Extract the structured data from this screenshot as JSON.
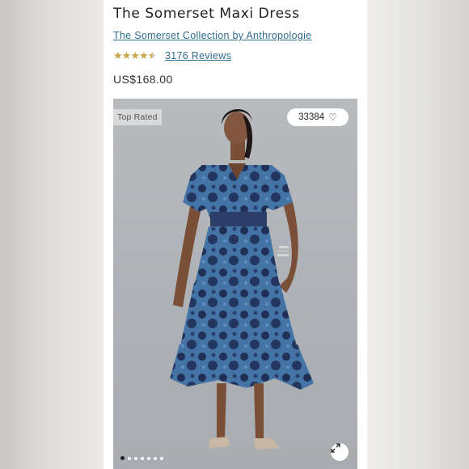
{
  "product": {
    "title": "The Somerset Maxi Dress",
    "collection": "The Somerset Collection by Anthropologie",
    "rating": 4.5,
    "reviews_label": "3176 Reviews",
    "price": "US$168.00"
  },
  "image": {
    "badge": "Top Rated",
    "likes": "33384",
    "carousel_dots": 7,
    "active_dot": 0,
    "icons": {
      "heart": "heart-icon",
      "expand": "expand-icon"
    }
  },
  "colors": {
    "link": "#2f6b8d",
    "star": "#caa64a",
    "dress": "#3e6c9c"
  }
}
